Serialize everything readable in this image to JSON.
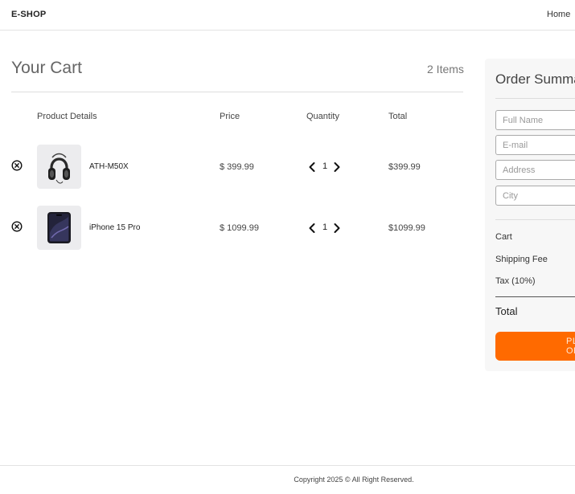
{
  "header": {
    "brand": "E-SHOP",
    "nav_home": "Home"
  },
  "cart": {
    "title": "Your Cart",
    "item_count": "2 Items",
    "columns": {
      "product": "Product Details",
      "price": "Price",
      "quantity": "Quantity",
      "total": "Total"
    },
    "items": [
      {
        "name": "ATH-M50X",
        "price": "$ 399.99",
        "quantity": "1",
        "total": "$399.99"
      },
      {
        "name": "iPhone 15 Pro",
        "price": "$ 1099.99",
        "quantity": "1",
        "total": "$1099.99"
      }
    ]
  },
  "summary": {
    "title": "Order Summary",
    "fields": {
      "full_name": "Full Name",
      "email": "E-mail",
      "address": "Address",
      "city": "City"
    },
    "cart_label": "Cart",
    "shipping_label": "Shipping Fee",
    "tax_label": "Tax (10%)",
    "total_label": "Total",
    "place_button": "PLACE ORDER"
  },
  "footer": {
    "copyright": "Copyright 2025 © All Right Reserved."
  },
  "colors": {
    "accent": "#ff6a00",
    "panel_bg": "#f7f7f7"
  }
}
